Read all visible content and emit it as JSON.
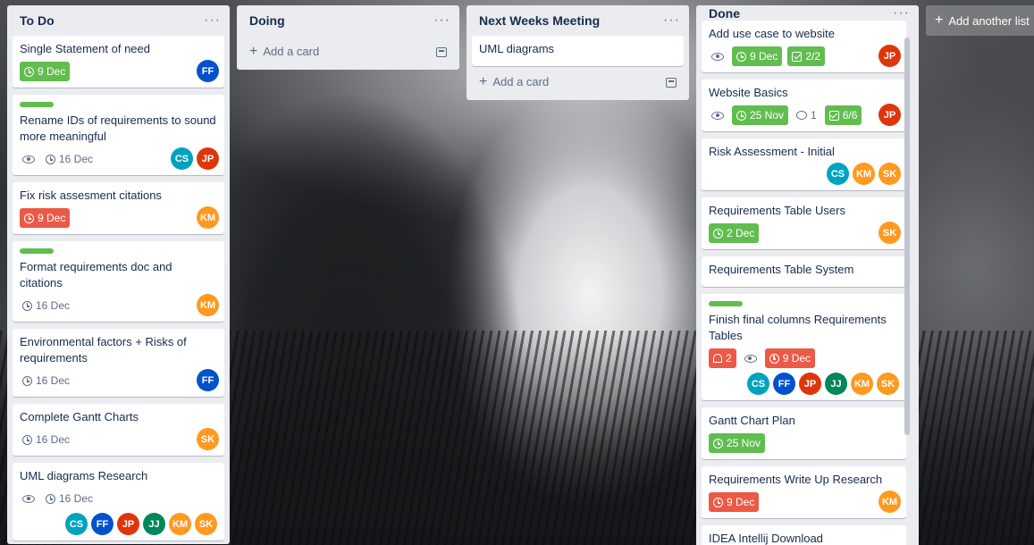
{
  "add_list_label": "Add another list",
  "lists": [
    {
      "title": "To Do",
      "cards": [
        {
          "title": "Single Statement of need",
          "due": "9 Dec",
          "due_style": "green",
          "members": [
            "FF"
          ]
        },
        {
          "title": "Rename IDs of requirements to sound more meaningful",
          "label": true,
          "watch": true,
          "due": "16 Dec",
          "due_style": "plain",
          "members": [
            "CS",
            "JP"
          ]
        },
        {
          "title": "Fix risk assesment citations",
          "due": "9 Dec",
          "due_style": "red",
          "members": [
            "KM"
          ]
        },
        {
          "title": "Format requirements doc and citations",
          "label": true,
          "due": "16 Dec",
          "due_style": "plain",
          "members": [
            "KM"
          ]
        },
        {
          "title": "Environmental factors + Risks of requirements",
          "due": "16 Dec",
          "due_style": "plain",
          "members": [
            "FF"
          ]
        },
        {
          "title": "Complete Gantt Charts",
          "due": "16 Dec",
          "due_style": "plain",
          "members": [
            "SK"
          ]
        },
        {
          "title": "UML diagrams Research",
          "watch": true,
          "due": "16 Dec",
          "due_style": "plain",
          "members": [
            "CS",
            "FF",
            "JP",
            "JJ",
            "KM",
            "SK"
          ]
        }
      ],
      "add_label": ""
    },
    {
      "title": "Doing",
      "cards": [],
      "add_label": "Add a card"
    },
    {
      "title": "Next Weeks Meeting",
      "cards": [
        {
          "title": "UML diagrams"
        }
      ],
      "add_label": "Add a card"
    },
    {
      "title": "Done",
      "cards": [
        {
          "title": "Add use case to website",
          "watch": true,
          "due": "9 Dec",
          "due_style": "green",
          "checklist": "2/2",
          "members": [
            "JP"
          ]
        },
        {
          "title": "Website Basics",
          "watch": true,
          "due": "25 Nov",
          "due_style": "green",
          "comments": "1",
          "checklist": "6/6",
          "members": [
            "JP"
          ]
        },
        {
          "title": "Risk Assessment - Initial",
          "members": [
            "CS",
            "KM",
            "SK"
          ]
        },
        {
          "title": "Requirements Table Users",
          "due": "2 Dec",
          "due_style": "green",
          "members": [
            "SK"
          ]
        },
        {
          "title": "Requirements Table System"
        },
        {
          "title": "Finish final columns Requirements Tables",
          "label": true,
          "notifications": "2",
          "watch": true,
          "due": "9 Dec",
          "due_style": "red",
          "members": [
            "CS",
            "FF",
            "JP",
            "JJ",
            "KM",
            "SK"
          ]
        },
        {
          "title": "Gantt Chart Plan",
          "due": "25 Nov",
          "due_style": "green"
        },
        {
          "title": "Requirements Write Up Research",
          "due": "9 Dec",
          "due_style": "red",
          "members": [
            "KM"
          ]
        },
        {
          "title": "IDEA Intellij Download"
        }
      ],
      "add_label": ""
    }
  ],
  "member_colors": {
    "FF": "#0052cc",
    "CS": "#00a3bf",
    "JP": "#de350b",
    "KM": "#ff991f",
    "SK": "#ff991f",
    "JJ": "#00875a"
  },
  "menu_glyph": "···"
}
